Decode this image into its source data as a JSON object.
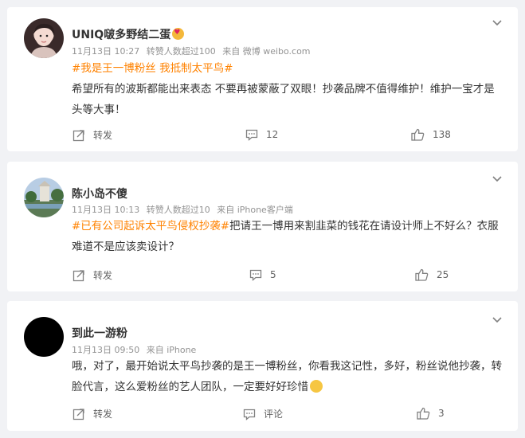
{
  "posts": [
    {
      "nickname": "UNIQ啵多野结二蛋",
      "date": "11月13日 10:27",
      "badge": "转赞人数超过100",
      "source": "来自 微博 weibo.com",
      "topic": "#我是王一博粉丝 我抵制太平鸟#",
      "body": "希望所有的波斯都能出来表态 不要再被蒙蔽了双眼！抄袭品牌不值得维护！维护一宝才是头等大事！",
      "repost_label": "转发",
      "comment_count": "12",
      "like_count": "138"
    },
    {
      "nickname": "陈小岛不傻",
      "date": "11月13日 10:13",
      "badge": "转赞人数超过10",
      "source": "来自 iPhone客户端",
      "topic": "#已有公司起诉太平鸟侵权抄袭#",
      "body": "把请王一博用来割韭菜的钱花在请设计师上不好么？衣服难道不是应该卖设计？",
      "repost_label": "转发",
      "comment_count": "5",
      "like_count": "25"
    },
    {
      "nickname": "到此一游粉",
      "date": "11月13日 09:50",
      "source": "来自 iPhone",
      "body": "哦，对了，最开始说太平鸟抄袭的是王一博粉丝，你看我这记性，多好，粉丝说他抄袭，转脸代言，这么爱粉丝的艺人团队，一定要好好珍惜",
      "repost_label": "转发",
      "comment_label": "评论",
      "like_count": "3"
    }
  ],
  "icons": [
    "chevron-down-icon",
    "repost-icon",
    "comment-icon",
    "like-icon"
  ],
  "colors": {
    "topic": "#ff8200",
    "meta": "#939393",
    "background": "#f1f2f5"
  }
}
